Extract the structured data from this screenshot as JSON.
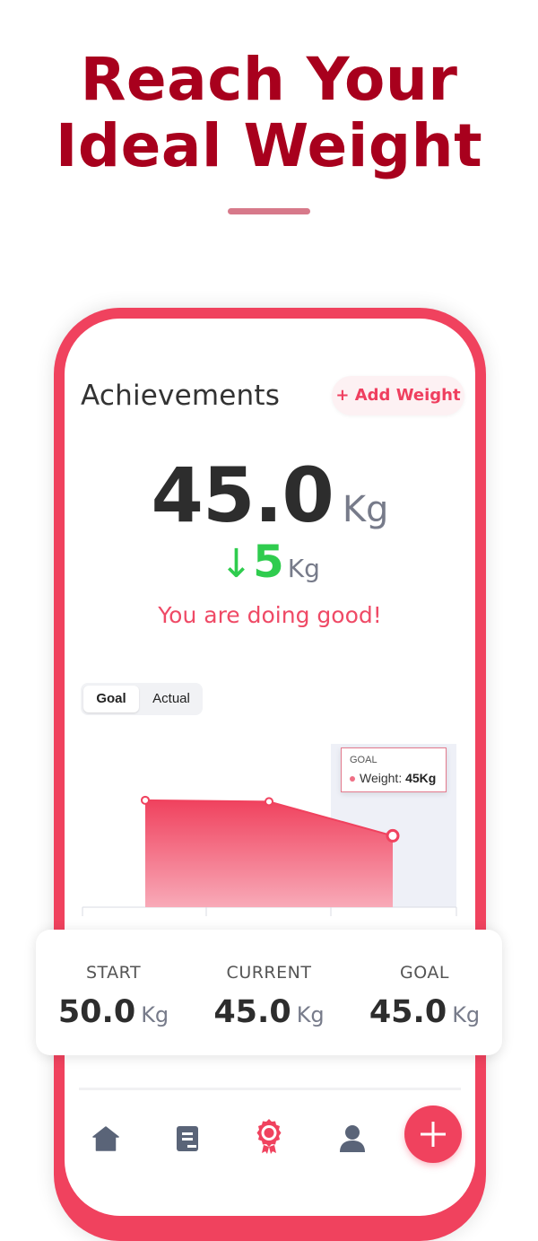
{
  "hero": {
    "title_line1": "Reach Your",
    "title_line2": "Ideal Weight"
  },
  "achievements": {
    "title": "Achievements",
    "add_button": "+ Add Weight",
    "current_weight": "45.0",
    "unit": "Kg",
    "delta_arrow": "↓",
    "delta_value": "5",
    "delta_unit": "Kg",
    "message": "You are doing good!"
  },
  "toggle": {
    "options": [
      "Goal",
      "Actual"
    ],
    "selected": "Goal"
  },
  "chart_data": {
    "type": "area",
    "x": [
      1,
      2,
      3
    ],
    "values": [
      50,
      49.8,
      45
    ],
    "tooltip": {
      "title": "GOAL",
      "label": "Weight:",
      "value": "45Kg"
    }
  },
  "stats": {
    "start": {
      "label": "START",
      "value": "50.0",
      "unit": "Kg"
    },
    "current": {
      "label": "CURRENT",
      "value": "45.0",
      "unit": "Kg"
    },
    "goal": {
      "label": "GOAL",
      "value": "45.0",
      "unit": "Kg"
    }
  },
  "nav": {
    "items": [
      "home-icon",
      "journal-icon",
      "achievement-icon",
      "profile-icon"
    ],
    "active": "achievement-icon",
    "fab": "plus-icon"
  },
  "colors": {
    "brand": "#a8001d",
    "accent": "#f0425e",
    "success": "#2fcc4e",
    "text_dark": "#2d2d2d",
    "muted": "#777b8a"
  }
}
